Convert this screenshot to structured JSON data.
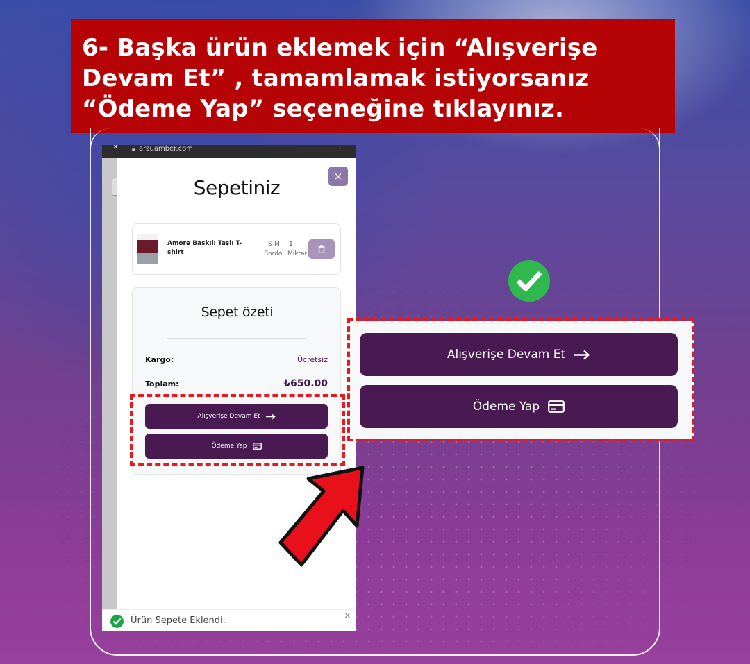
{
  "instruction": {
    "lines": [
      "6- Başka ürün eklemek için “Alışverişe",
      "Devam Et” , tamamlamak istiyorsanız",
      "“Ödeme Yap” seçeneğine tıklayınız."
    ]
  },
  "browser": {
    "url": "arzuamber.com"
  },
  "cart": {
    "title": "Sepetiniz",
    "close_label": "×",
    "item": {
      "name": "Amore Baskılı Taşlı T-shirt",
      "size": "S-M",
      "quantity": "1",
      "color": "Bordo",
      "quantity_label": "Miktar"
    },
    "summary": {
      "title": "Sepet özeti",
      "shipping_label": "Kargo:",
      "shipping_value": "Ücretsiz",
      "total_label": "Toplam:",
      "total_value": "₺650.00"
    },
    "continue_button": "Alışverişe Devam Et",
    "checkout_button": "Ödeme Yap"
  },
  "toast": {
    "message": "Ürün Sepete Eklendi.",
    "close_label": "×"
  },
  "zoom": {
    "continue_button": "Alışverişe Devam Et",
    "checkout_button": "Ödeme Yap"
  },
  "colors": {
    "banner": "#b50306",
    "button": "#491a52",
    "highlight": "#e8181e",
    "check": "#2fb84e"
  }
}
